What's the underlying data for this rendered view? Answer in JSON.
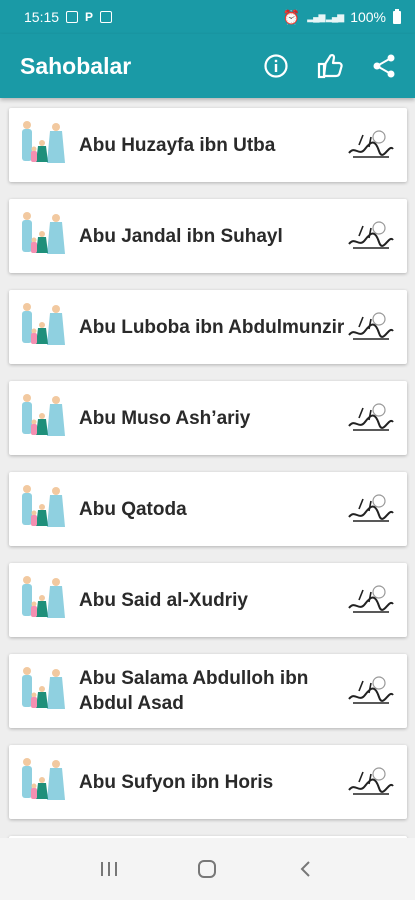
{
  "status": {
    "time": "15:15",
    "battery": "100%"
  },
  "app_bar": {
    "title": "Sahobalar",
    "actions": [
      "info-icon",
      "thumbs-up-icon",
      "share-icon"
    ]
  },
  "colors": {
    "primary": "#1a9aa6",
    "background": "#eeeeee",
    "card": "#ffffff",
    "text": "#2a2a2a"
  },
  "items": [
    {
      "name": "Abu Huzayfa ibn Utba"
    },
    {
      "name": "Abu Jandal ibn Suhayl"
    },
    {
      "name": "Abu Luboba ibn Abdulmunzir"
    },
    {
      "name": "Abu Muso Ash’ariy"
    },
    {
      "name": "Abu Qatoda"
    },
    {
      "name": "Abu Said al-Xudriy"
    },
    {
      "name": "Abu Salama Abdulloh ibn Abdul Asad"
    },
    {
      "name": "Abu Sufyon ibn Horis"
    }
  ],
  "nav": [
    "recent-apps-icon",
    "home-icon",
    "back-icon"
  ]
}
